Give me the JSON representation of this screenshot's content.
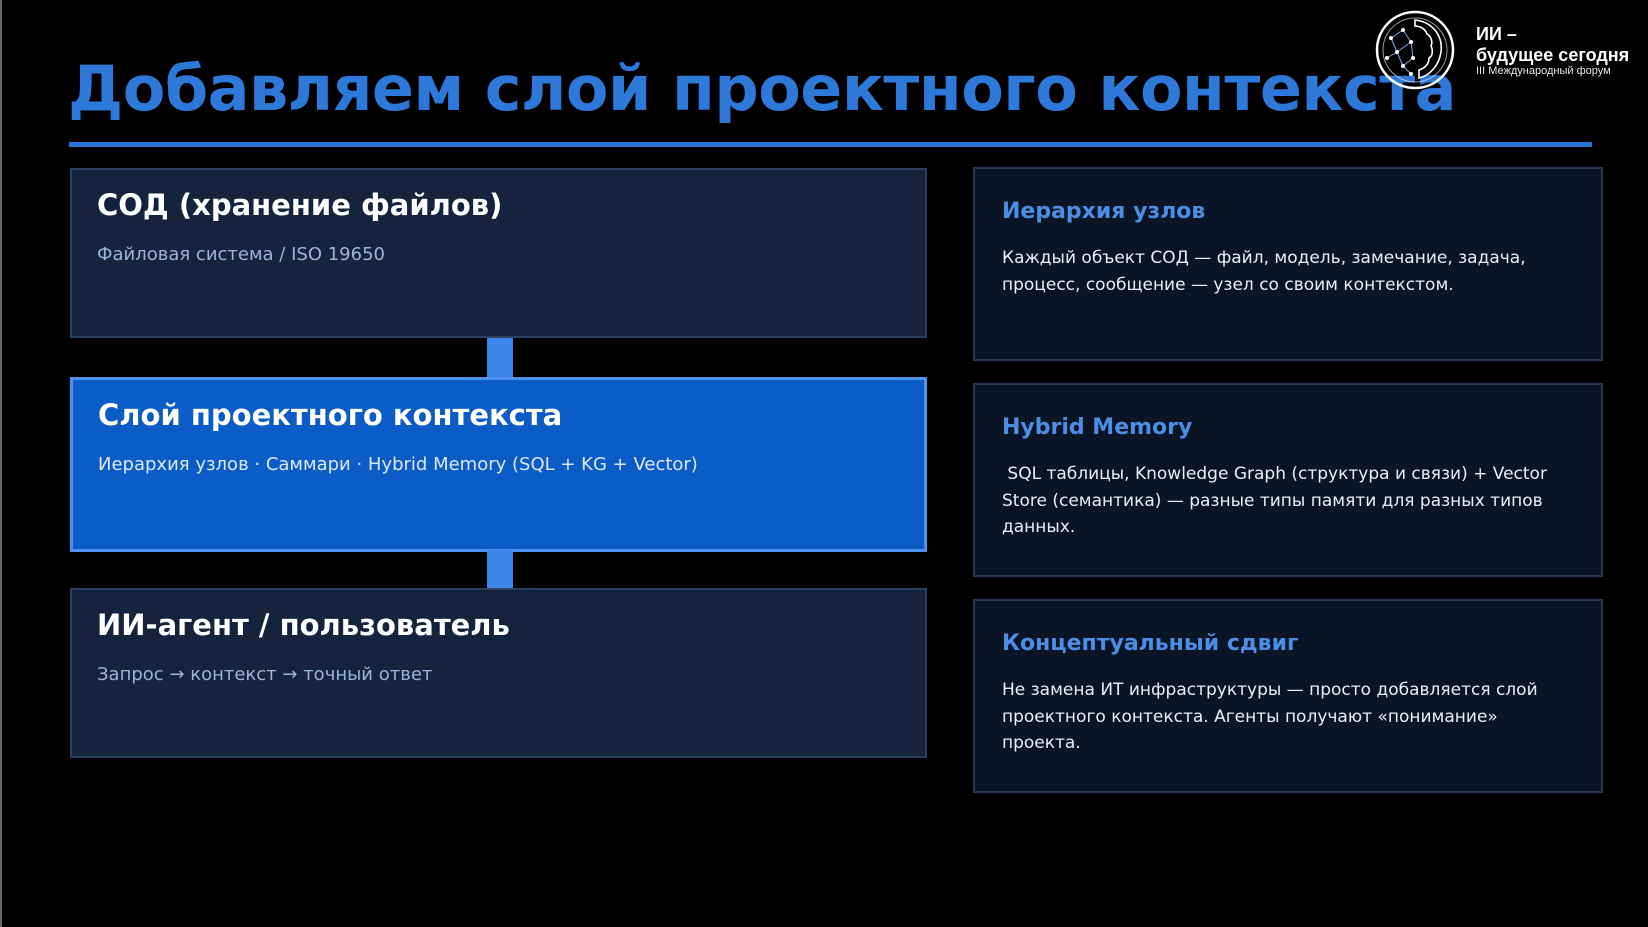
{
  "slide": {
    "title": "Добавляем слой проектного контекста"
  },
  "logo": {
    "title_line1": "ИИ –",
    "title_line2": "будущее сегодня",
    "subtitle": "III Международный форум"
  },
  "colors": {
    "background": "#000000",
    "title_blue": "#2e78da",
    "active_layer": "#0b5cc6",
    "layer_bg": "#15233d",
    "card_bg": "#0a1427",
    "card_title": "#4b8ee4"
  },
  "layers": [
    {
      "title": "СОД (хранение файлов)",
      "subtitle": "Файловая система / ISO 19650"
    },
    {
      "title": "Слой проектного контекста",
      "subtitle": "Иерархия узлов · Саммари  · Hybrid Memory (SQL + KG + Vector)"
    },
    {
      "title": "ИИ-агент / пользователь",
      "subtitle": "Запрос → контекст → точный ответ"
    }
  ],
  "cards": [
    {
      "title": "Иерархия узлов",
      "text": "Каждый объект СОД — файл, модель, замечание, задача, процесс, сообщение — узел со своим контекстом."
    },
    {
      "title": "Hybrid Memory",
      "text": " SQL таблицы, Knowledge Graph (структура и связи) + Vector Store (семантика) — разные типы памяти для разных типов данных."
    },
    {
      "title": "Концептуальный сдвиг",
      "text": "Не замена ИТ инфраструктуры — просто добавляется слой проектного контекста. Агенты получают «понимание» проекта."
    }
  ]
}
